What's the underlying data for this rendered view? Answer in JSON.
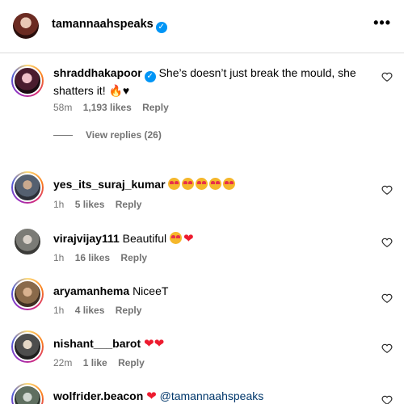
{
  "post": {
    "username": "tamannaahspeaks"
  },
  "comments": [
    {
      "username": "shraddhakapoor",
      "text": "She’s doesn’t just break the mould, she shatters it!",
      "time": "58m",
      "likes": "1,193 likes",
      "reply": "Reply"
    },
    {
      "username": "yes_its_suraj_kumar",
      "text": "",
      "time": "1h",
      "likes": "5 likes",
      "reply": "Reply"
    },
    {
      "username": "virajvijay111",
      "text": "Beautiful",
      "time": "1h",
      "likes": "16 likes",
      "reply": "Reply"
    },
    {
      "username": "aryamanhema",
      "text": "NiceeT",
      "time": "1h",
      "likes": "4 likes",
      "reply": "Reply"
    },
    {
      "username": "nishant___barot",
      "text": "",
      "time": "22m",
      "likes": "1 like",
      "reply": "Reply"
    },
    {
      "username": "wolfrider.beacon",
      "text": "@tamannaahspeaks",
      "time": "",
      "likes": "",
      "reply": ""
    }
  ],
  "view_replies": "View replies (26)",
  "icons": {
    "more": "more-options-icon",
    "like": "heart-outline-icon",
    "verified": "verified-badge-icon"
  }
}
